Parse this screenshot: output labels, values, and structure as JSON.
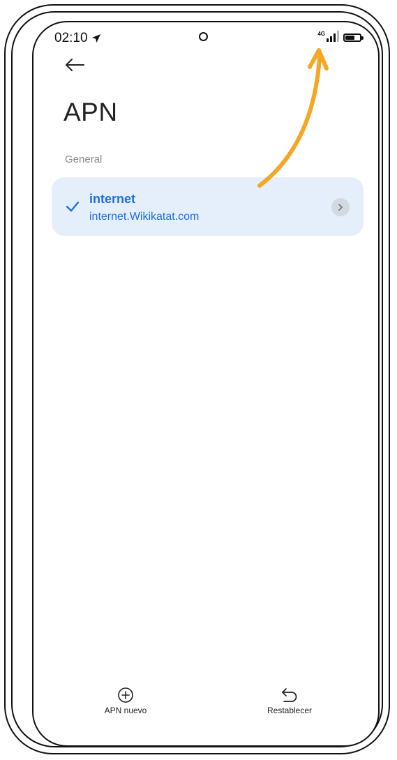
{
  "status_bar": {
    "time": "02:10",
    "network": "4G"
  },
  "header": {
    "title": "APN"
  },
  "section": {
    "label": "General"
  },
  "apn_list": [
    {
      "name": "internet",
      "value": "internet.Wikikatat.com",
      "selected": true
    }
  ],
  "bottom_bar": {
    "new_label": "APN nuevo",
    "reset_label": "Restablecer"
  },
  "colors": {
    "accent": "#1f6fe0",
    "card_bg": "#e5eefb",
    "annotation_arrow": "#f5a623"
  },
  "icons": {
    "back": "arrow-left-icon",
    "check": "check-icon",
    "chevron": "chevron-right-icon",
    "add": "plus-circle-icon",
    "reset": "undo-icon",
    "location": "location-arrow-icon",
    "signal": "signal-icon",
    "battery": "battery-icon"
  }
}
